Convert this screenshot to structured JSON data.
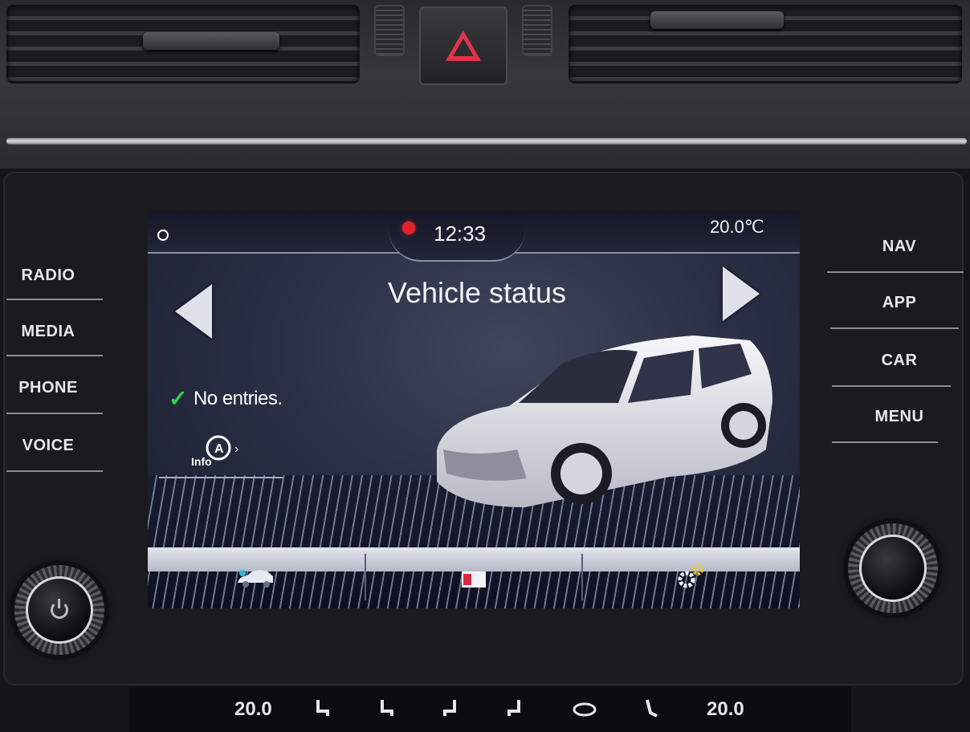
{
  "status_bar": {
    "time": "12:33",
    "temperature": "20.0℃"
  },
  "screen": {
    "title": "Vehicle status",
    "message": "No entries.",
    "info_label": "Info"
  },
  "hard_buttons": {
    "left": [
      "RADIO",
      "MEDIA",
      "PHONE",
      "VOICE"
    ],
    "right": [
      "NAV",
      "APP",
      "CAR",
      "MENU"
    ]
  },
  "bottom_tabs": [
    {
      "icon": "vehicle-icon"
    },
    {
      "icon": "logbook-icon"
    },
    {
      "icon": "settings-gears-icon"
    }
  ],
  "climate": {
    "left_temp": "20.0",
    "right_temp": "20.0"
  },
  "colors": {
    "ok_check": "#34d24a",
    "hazard": "#e2334a",
    "recording_dot": "#e3222e"
  }
}
